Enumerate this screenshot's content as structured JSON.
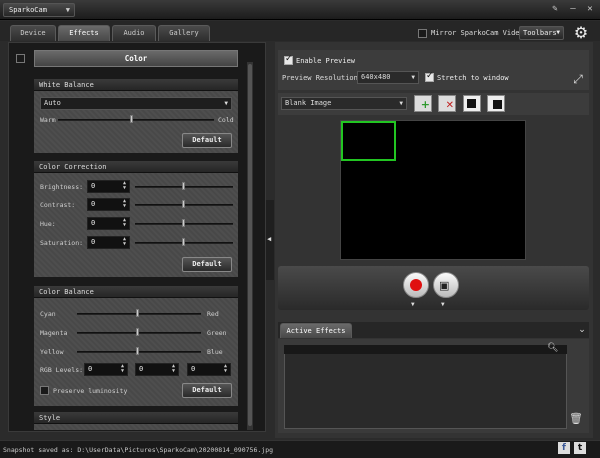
{
  "app": {
    "title": "SparkoCam"
  },
  "tabs": [
    {
      "label": "Device"
    },
    {
      "label": "Effects"
    },
    {
      "label": "Audio"
    },
    {
      "label": "Gallery"
    }
  ],
  "topbar": {
    "mirror_label": "Mirror SparkoCam Video",
    "toolbars_label": "Toolbars"
  },
  "color_section": {
    "title": "Color"
  },
  "white_balance": {
    "title": "White Balance",
    "mode": "Auto",
    "warm_label": "Warm",
    "cold_label": "Cold",
    "default_label": "Default"
  },
  "color_correction": {
    "title": "Color Correction",
    "default_label": "Default",
    "rows": [
      {
        "label": "Brightness:",
        "value": "0"
      },
      {
        "label": "Contrast:",
        "value": "0"
      },
      {
        "label": "Hue:",
        "value": "0"
      },
      {
        "label": "Saturation:",
        "value": "0"
      }
    ]
  },
  "color_balance": {
    "title": "Color Balance",
    "default_label": "Default",
    "rows": [
      {
        "left": "Cyan",
        "right": "Red"
      },
      {
        "left": "Magenta",
        "right": "Green"
      },
      {
        "left": "Yellow",
        "right": "Blue"
      }
    ],
    "rgb_label": "RGB Levels:",
    "rgb_values": [
      "0",
      "0",
      "0"
    ],
    "preserve_label": "Preserve luminosity"
  },
  "style_section": {
    "title": "Style"
  },
  "preview": {
    "enable_label": "Enable Preview",
    "resolution_label": "Preview Resolution:",
    "resolution_value": "640x480",
    "stretch_label": "Stretch to window"
  },
  "overlay": {
    "selected": "Blank Image"
  },
  "effects": {
    "tab_label": "Active Effects"
  },
  "status": {
    "text": "Snapshot saved as: D:\\UserData\\Pictures\\SparkoCam\\20200814_090756.jpg"
  },
  "colors": {
    "record": "#e01010",
    "selection": "#22c522",
    "accent_green": "#2f9a2f",
    "accent_red": "#c02020"
  }
}
